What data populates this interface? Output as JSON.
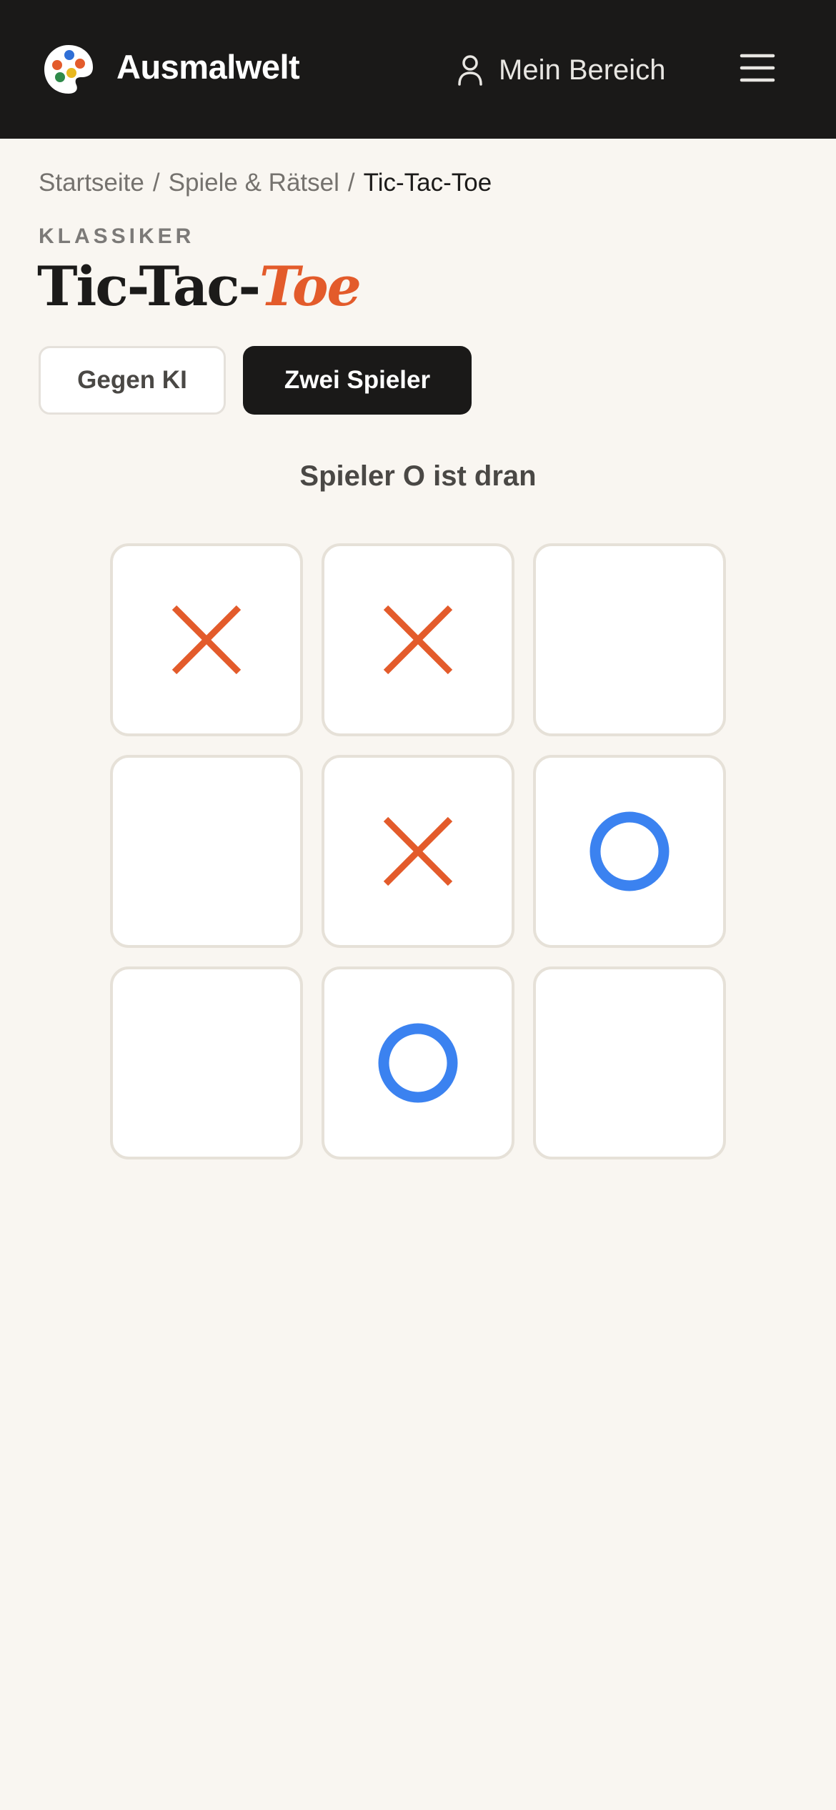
{
  "header": {
    "brand": "Ausmalwelt",
    "account_label": "Mein Bereich"
  },
  "breadcrumb": {
    "items": [
      "Startseite",
      "Spiele & Rätsel"
    ],
    "separator": "/",
    "current": "Tic-Tac-Toe"
  },
  "page": {
    "eyebrow": "KLASSIKER",
    "title_plain": "Tic-Tac-",
    "title_accent": "Toe"
  },
  "modes": {
    "ai_label": "Gegen KI",
    "two_player_label": "Zwei Spieler",
    "active": "two_player"
  },
  "game": {
    "status": "Spieler O ist dran",
    "board": [
      "X",
      "X",
      "",
      "",
      "X",
      "O",
      "",
      "O",
      ""
    ]
  },
  "colors": {
    "x": "#e35b2b",
    "o": "#3b82f0",
    "header_bg": "#1a1918",
    "page_bg": "#f9f6f1"
  },
  "icons": {
    "logo": "palette-icon",
    "account": "user-icon",
    "menu": "hamburger-menu-icon"
  }
}
